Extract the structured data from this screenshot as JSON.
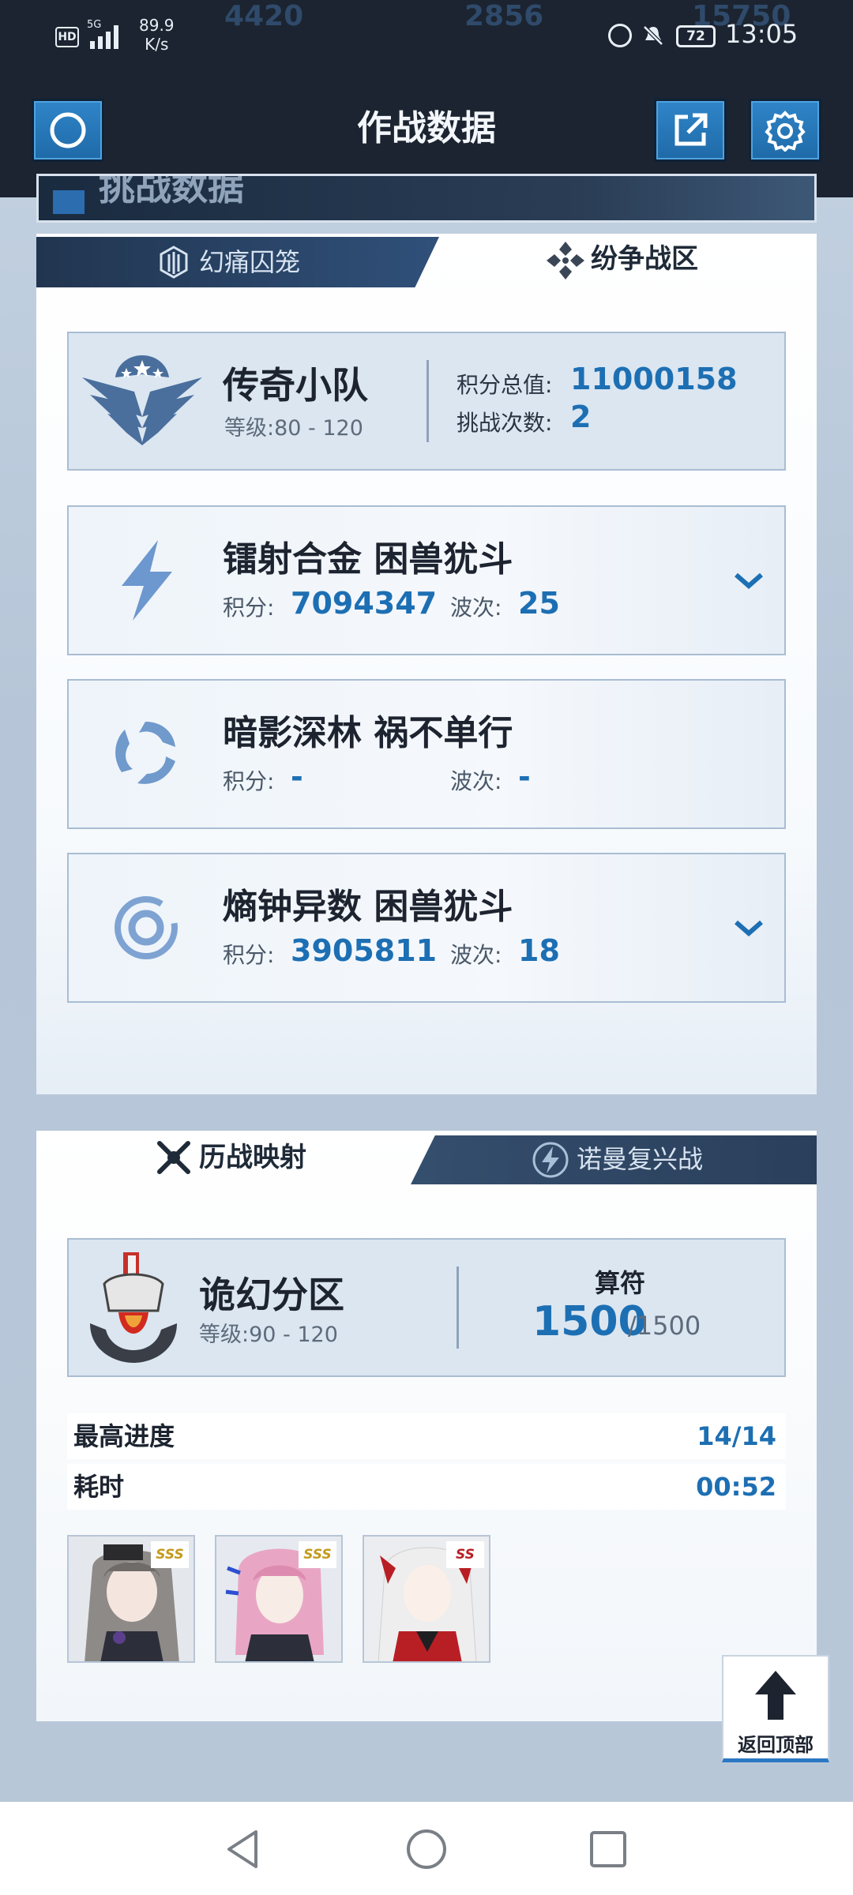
{
  "status_bar": {
    "hd": "HD",
    "network": "5G",
    "speed_value": "89.9",
    "speed_unit": "K/s",
    "battery": "72",
    "time": "13:05",
    "ghost_numbers": [
      "4420",
      "2856",
      "15750"
    ]
  },
  "header": {
    "title": "作战数据",
    "left_icon": "circle-icon",
    "share_icon": "external-link-icon",
    "settings_icon": "gear-icon"
  },
  "banner": {
    "title": "挑战数据"
  },
  "panel1": {
    "tabs": [
      {
        "label": "幻痛囚笼",
        "icon": "cage-icon",
        "active": false
      },
      {
        "label": "纷争战区",
        "icon": "war-zone-icon",
        "active": true
      }
    ],
    "team": {
      "name": "传奇小队",
      "level_label": "等级:",
      "level_value": "80 - 120",
      "total_label": "积分总值:",
      "total_value": "11000158",
      "attempts_label": "挑战次数:",
      "attempts_value": "2"
    },
    "bosses": [
      {
        "title": "镭射合金 困兽犹斗",
        "score_label": "积分:",
        "score": "7094347",
        "wave_label": "波次:",
        "wave": "25",
        "icon": "lightning-icon",
        "expandable": true
      },
      {
        "title": "暗影深林 祸不单行",
        "score_label": "积分:",
        "score": "-",
        "wave_label": "波次:",
        "wave": "-",
        "icon": "swirl-icon",
        "expandable": false
      },
      {
        "title": "熵钟异数 困兽犹斗",
        "score_label": "积分:",
        "score": "3905811",
        "wave_label": "波次:",
        "wave": "18",
        "icon": "ring-icon",
        "expandable": true
      }
    ]
  },
  "panel2": {
    "tabs": [
      {
        "label": "历战映射",
        "icon": "crossed-guns-icon",
        "active": true
      },
      {
        "label": "诺曼复兴战",
        "icon": "bolt-circle-icon",
        "active": false
      }
    ],
    "zone": {
      "name": "诡幻分区",
      "level_label": "等级:",
      "level_value": "90 - 120",
      "suanfu_label": "算符",
      "suanfu_value": "1500",
      "suanfu_max": "/1500"
    },
    "progress_label": "最高进度",
    "progress_value": "14/14",
    "time_label": "耗时",
    "time_value": "00:52",
    "characters": [
      {
        "rank": "SSS",
        "hair": "#8e8a88",
        "accent": "#5b3f8c"
      },
      {
        "rank": "SSS",
        "hair": "#e9a6c4",
        "accent": "#2c2f3a"
      },
      {
        "rank": "SS",
        "hair": "#eeeeee",
        "accent": "#b81f24"
      }
    ]
  },
  "back_to_top": {
    "label": "返回顶部"
  },
  "colors": {
    "accent_blue": "#1d6fb3",
    "header_bg": "#1b2430",
    "tab_dark": "#21354f"
  }
}
